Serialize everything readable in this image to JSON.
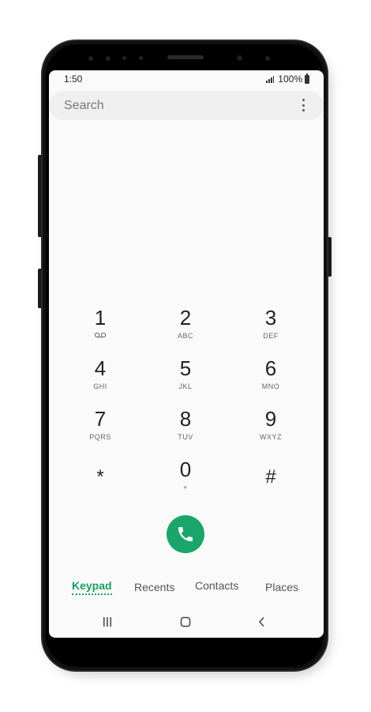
{
  "status": {
    "time": "1:50",
    "battery": "100%"
  },
  "search": {
    "placeholder": "Search"
  },
  "keypad": [
    {
      "num": "1",
      "sub": ""
    },
    {
      "num": "2",
      "sub": "ABC"
    },
    {
      "num": "3",
      "sub": "DEF"
    },
    {
      "num": "4",
      "sub": "GHI"
    },
    {
      "num": "5",
      "sub": "JKL"
    },
    {
      "num": "6",
      "sub": "MNO"
    },
    {
      "num": "7",
      "sub": "PQRS"
    },
    {
      "num": "8",
      "sub": "TUV"
    },
    {
      "num": "9",
      "sub": "WXYZ"
    },
    {
      "num": "*",
      "sub": ""
    },
    {
      "num": "0",
      "sub": "+"
    },
    {
      "num": "#",
      "sub": ""
    }
  ],
  "tabs": {
    "keypad": "Keypad",
    "recents": "Recents",
    "contacts": "Contacts",
    "places": "Places"
  },
  "colors": {
    "accent": "#1b9e63",
    "call": "#1aa56b"
  }
}
